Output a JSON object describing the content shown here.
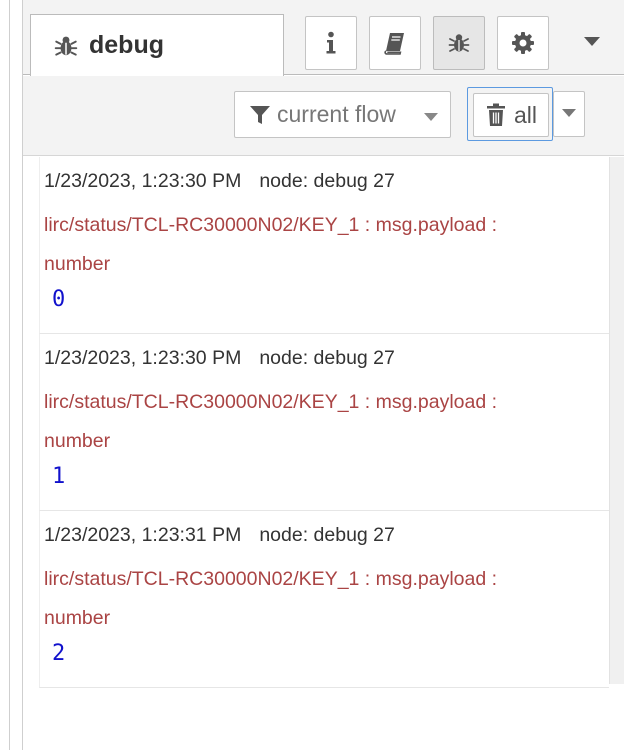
{
  "tabs": {
    "active_label": "debug",
    "active_icon": "bug-icon",
    "buttons": [
      {
        "name": "info",
        "icon": "info-icon"
      },
      {
        "name": "help",
        "icon": "book-icon"
      },
      {
        "name": "debug",
        "icon": "bug-icon",
        "selected": true
      },
      {
        "name": "config",
        "icon": "gear-icon"
      }
    ],
    "menu_icon": "caret-down-icon"
  },
  "toolbar": {
    "filter_label": "current flow",
    "clear_label": "all"
  },
  "messages": [
    {
      "timestamp": "1/23/2023, 1:23:30 PM",
      "node": "node: debug 27",
      "topic": "lirc/status/TCL-RC30000N02/KEY_1 : msg.payload : number",
      "value": "0"
    },
    {
      "timestamp": "1/23/2023, 1:23:30 PM",
      "node": "node: debug 27",
      "topic": "lirc/status/TCL-RC30000N02/KEY_1 : msg.payload : number",
      "value": "1"
    },
    {
      "timestamp": "1/23/2023, 1:23:31 PM",
      "node": "node: debug 27",
      "topic": "lirc/status/TCL-RC30000N02/KEY_1 : msg.payload : number",
      "value": "2"
    }
  ],
  "colors": {
    "topic": "#aa4444",
    "value": "#1111cc",
    "focus_border": "#5c9ae0"
  }
}
